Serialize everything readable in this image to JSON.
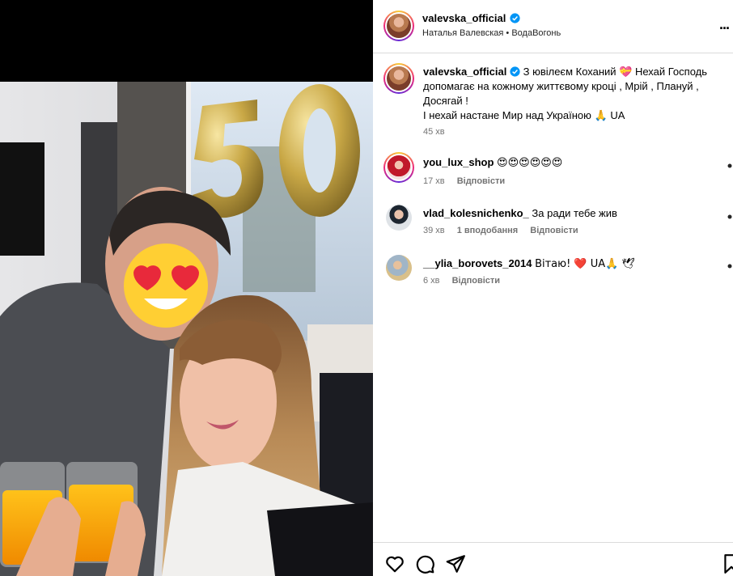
{
  "post": {
    "author": "valevska_official",
    "subtitle": "Наталья Валевская • ВодаВогонь",
    "caption_line1_text": "З ювілеєм Коханий 💝 Нехай Господь",
    "caption_line2": "допомагає на кожному життєвому кроці , Мрій , Плануй ,",
    "caption_line3": "Досягай !",
    "caption_line4": "І нехай настане Мир над Україною 🙏 UA",
    "caption_time": "45 хв",
    "photo_balloon_text": "50"
  },
  "comments": [
    {
      "user": "you_lux_shop",
      "text": "😍😍😍😍😍😍",
      "time": "17 хв",
      "reply": "Відповісти",
      "likes": ""
    },
    {
      "user": "vlad_kolesnichenko_",
      "text": "За ради тебе жив",
      "time": "39 хв",
      "likes": "1 вподобання",
      "reply": "Відповісти"
    },
    {
      "user": "__ylia_borovets_2014",
      "text": "Вітаю! ❤️ UA🙏 🕊",
      "time": "6 хв",
      "reply": "Відповісти",
      "likes": ""
    }
  ],
  "header": {
    "more_label": "..."
  },
  "icons": [
    "more-icon",
    "verified-icon",
    "heart-icon",
    "comment-icon",
    "share-icon",
    "bookmark-icon"
  ],
  "colors": {
    "verified": "#0095f6",
    "muted": "#737373",
    "border": "#dbdbdb"
  }
}
